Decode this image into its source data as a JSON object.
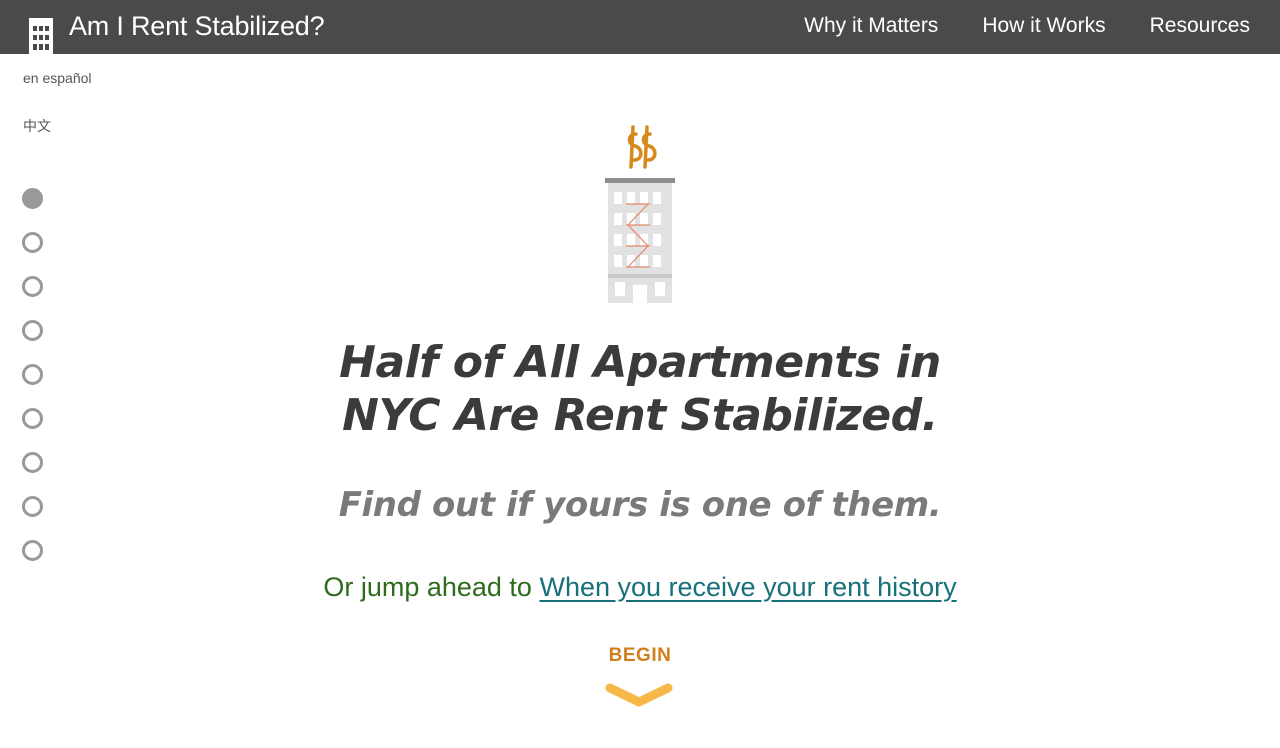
{
  "header": {
    "logo_icon": "building-icon",
    "title": "Am I Rent Stabilized?",
    "nav": [
      "Why it Matters",
      "How it Works",
      "Resources"
    ]
  },
  "languages": {
    "spanish": "en español",
    "chinese": "中文"
  },
  "progress": {
    "total_steps": 9,
    "current_step": 1
  },
  "hero": {
    "icon": "building-with-dollar-smoke-icon",
    "headline_line1": "Half of All Apartments in",
    "headline_line2": "NYC Are Rent Stabilized.",
    "subhead": "Find out if yours is one of them.",
    "jump_prefix": "Or jump ahead to",
    "jump_link": "When you receive your rent history",
    "begin_label": "BEGIN",
    "begin_icon": "chevron-down-icon"
  },
  "colors": {
    "header_bg": "#4a4a4a",
    "headline": "#3b3b3b",
    "subhead": "#7a7a7a",
    "jump_text": "#2e6b1c",
    "jump_link": "#17707a",
    "begin": "#d07f1c",
    "chevron": "#f7b84a",
    "dollar": "#d48a1c"
  }
}
